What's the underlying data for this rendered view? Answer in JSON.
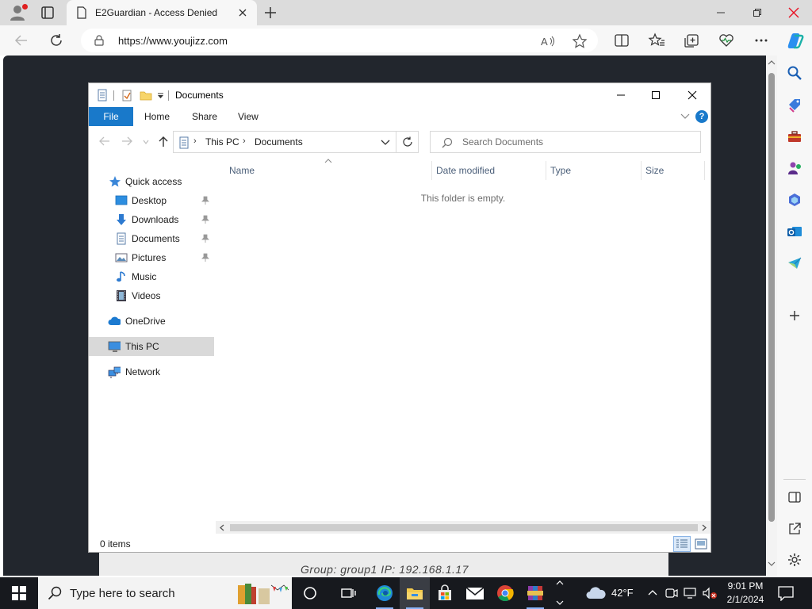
{
  "browser": {
    "tab_title": "E2Guardian - Access Denied",
    "url": "https://www.youjizz.com",
    "colors": {
      "tabbar": "#dcdcdc",
      "toolbar": "#f7f7f7",
      "page_bg": "#22262d"
    }
  },
  "page": {
    "group_text": "Group: group1    IP: 192.168.1.17"
  },
  "explorer": {
    "title": "Documents",
    "ribbon": {
      "file": "File",
      "home": "Home",
      "share": "Share",
      "view": "View",
      "help": "?"
    },
    "address": {
      "segment_1": "This PC",
      "segment_2": "Documents",
      "chevron": "›"
    },
    "search_placeholder": "Search Documents",
    "nav_pane": {
      "quick_access": "Quick access",
      "desktop": "Desktop",
      "downloads": "Downloads",
      "documents": "Documents",
      "pictures": "Pictures",
      "music": "Music",
      "videos": "Videos",
      "onedrive": "OneDrive",
      "this_pc": "This PC",
      "network": "Network"
    },
    "columns": {
      "name": "Name",
      "date_modified": "Date modified",
      "type": "Type",
      "size": "Size"
    },
    "empty_message": "This folder is empty.",
    "status": "0 items",
    "accent": "#1979ca"
  },
  "taskbar": {
    "search_placeholder": "Type here to search",
    "weather": "42°F",
    "time": "9:01 PM",
    "date": "2/1/2024"
  }
}
